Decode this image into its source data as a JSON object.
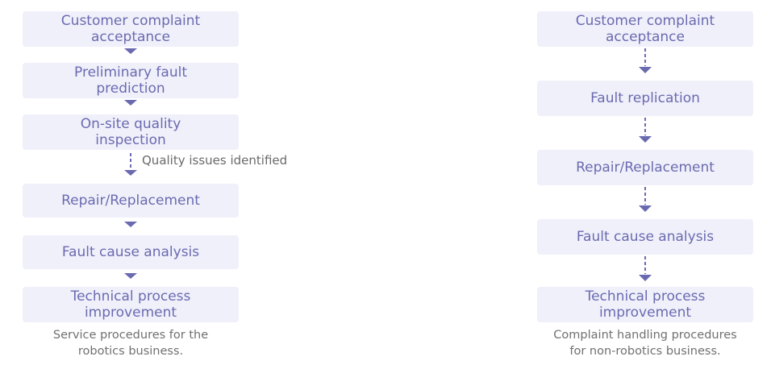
{
  "left_flow": {
    "steps": [
      "Customer complaint\nacceptance",
      "Preliminary fault\nprediction",
      "On-site quality\ninspection",
      "Repair/Replacement",
      "Fault cause analysis",
      "Technical process\nimprovement"
    ],
    "branch_label": "Quality issues identified",
    "caption": "Service procedures for the\nrobotics business."
  },
  "right_flow": {
    "steps": [
      "Customer complaint\nacceptance",
      "Fault replication",
      "Repair/Replacement",
      "Fault cause analysis",
      "Technical process\nimprovement"
    ],
    "caption": "Complaint handling procedures\nfor non-robotics business."
  },
  "colors": {
    "box_fill": "#f0f0fb",
    "text": "#6a6ab0",
    "arrow": "#6a6ab0"
  }
}
